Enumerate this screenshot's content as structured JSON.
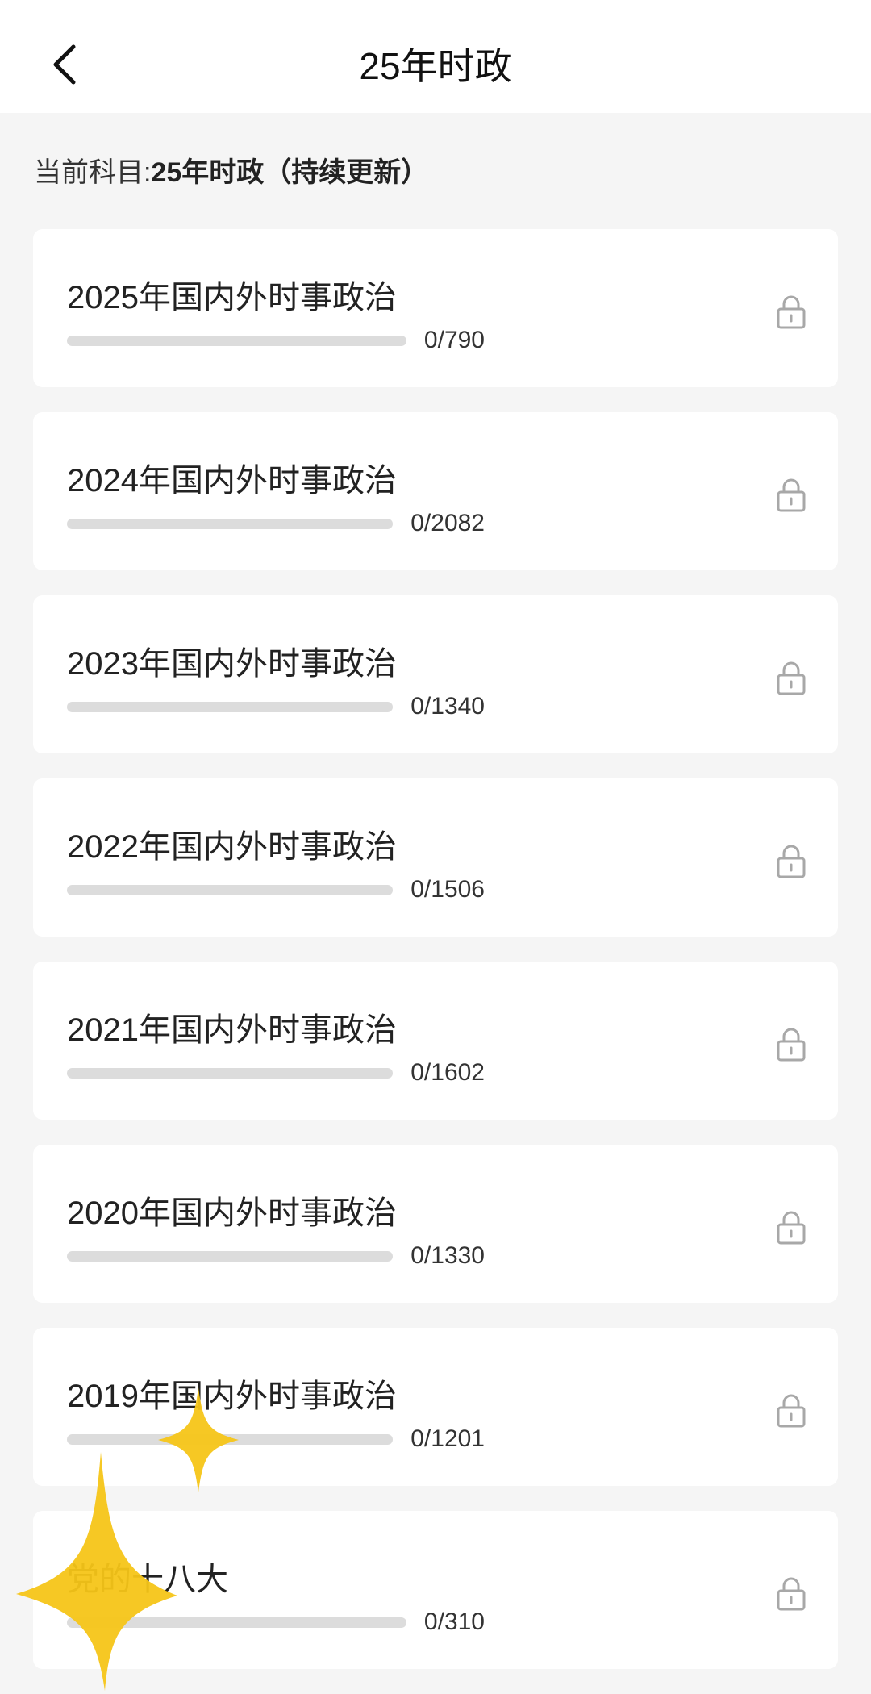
{
  "header": {
    "back_icon": "chevron-left-icon",
    "title": "25年时政"
  },
  "subject": {
    "label": "当前科目:",
    "value": "25年时政（持续更新）"
  },
  "items": [
    {
      "title": "2025年国内外时事政治",
      "done": 0,
      "total": 790,
      "count": "0/790",
      "lock_icon": "lock-icon"
    },
    {
      "title": "2024年国内外时事政治",
      "done": 0,
      "total": 2082,
      "count": "0/2082",
      "lock_icon": "lock-icon"
    },
    {
      "title": "2023年国内外时事政治",
      "done": 0,
      "total": 1340,
      "count": "0/1340",
      "lock_icon": "lock-icon"
    },
    {
      "title": "2022年国内外时事政治",
      "done": 0,
      "total": 1506,
      "count": "0/1506",
      "lock_icon": "lock-icon"
    },
    {
      "title": "2021年国内外时事政治",
      "done": 0,
      "total": 1602,
      "count": "0/1602",
      "lock_icon": "lock-icon"
    },
    {
      "title": "2020年国内外时事政治",
      "done": 0,
      "total": 1330,
      "count": "0/1330",
      "lock_icon": "lock-icon"
    },
    {
      "title": "2019年国内外时事政治",
      "done": 0,
      "total": 1201,
      "count": "0/1201",
      "lock_icon": "lock-icon"
    },
    {
      "title": "党的十八大",
      "done": 0,
      "total": 310,
      "count": "0/310",
      "lock_icon": "lock-icon"
    }
  ],
  "colors": {
    "accent": "#f5c518",
    "background": "#f5f5f5",
    "card": "#ffffff"
  }
}
